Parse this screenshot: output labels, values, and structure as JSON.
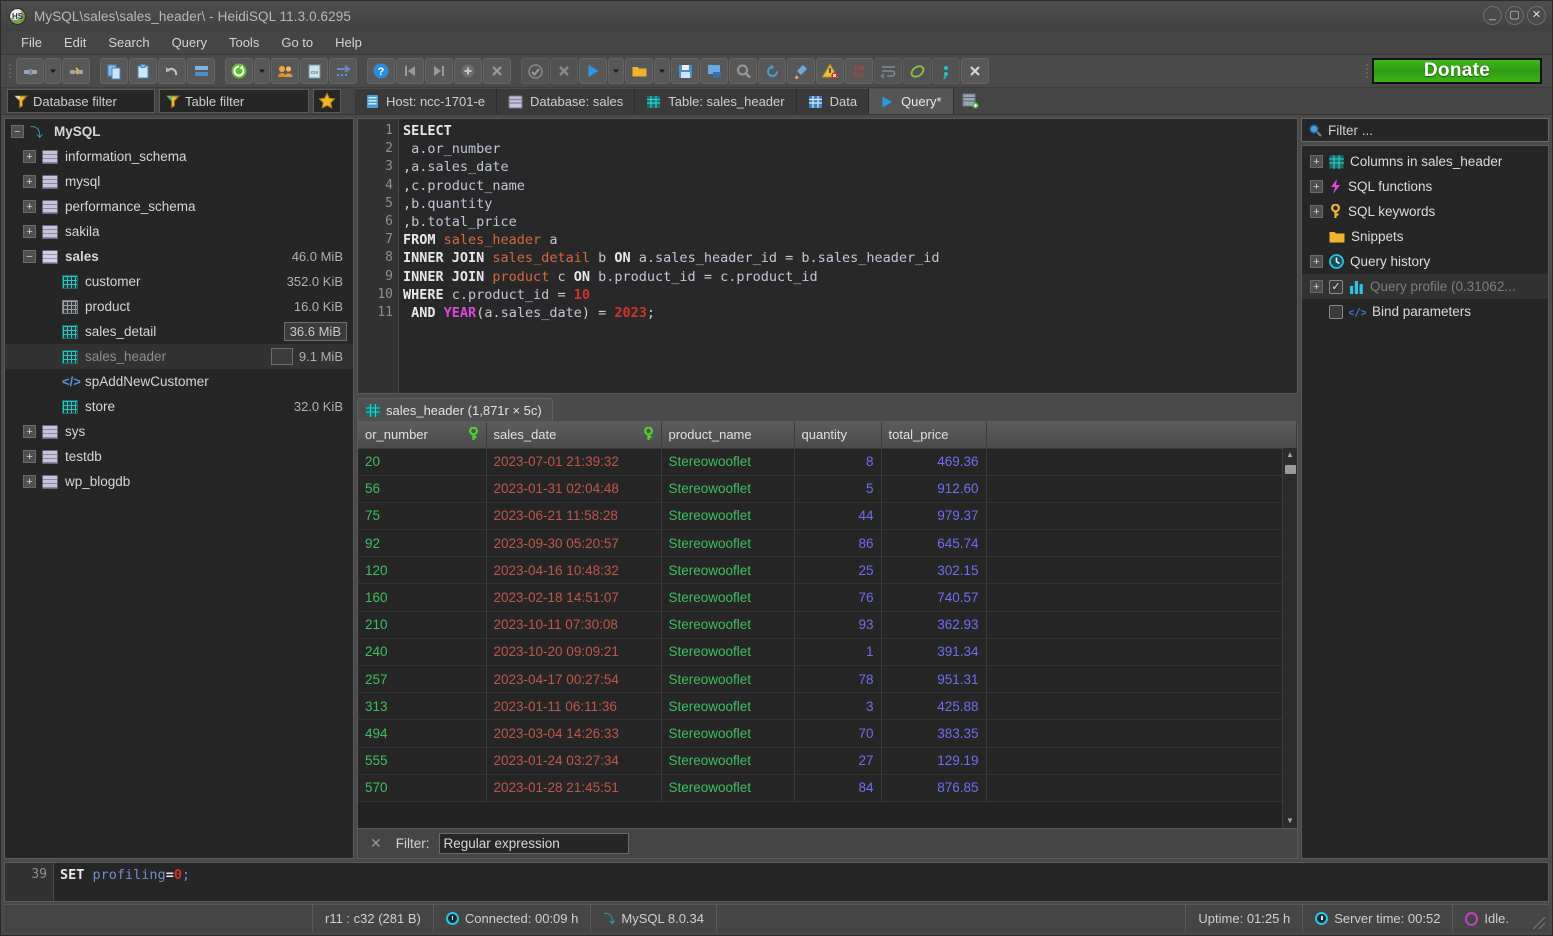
{
  "window": {
    "title": "MySQL\\sales\\sales_header\\ - HeidiSQL 11.3.0.6295",
    "logo_text": "HS",
    "minimize": "_",
    "maximize": "▢",
    "close": "✕"
  },
  "menubar": {
    "items": [
      "File",
      "Edit",
      "Search",
      "Query",
      "Tools",
      "Go to",
      "Help"
    ]
  },
  "toolbar": {
    "donate_label": "Donate",
    "buttons": [
      "connect-icon",
      "connect-dropdown-icon",
      "disconnect-icon",
      "copy-icon",
      "paste-icon",
      "undo-icon",
      "save-icon",
      "refresh-icon",
      "refresh-dropdown-icon",
      "users-icon",
      "csv-export-icon",
      "transfer-icon",
      "help-icon",
      "first-icon",
      "last-icon",
      "add-icon",
      "delete-icon",
      "commit-icon",
      "rollback-icon",
      "run-icon",
      "run-dropdown-icon",
      "open-folder-icon",
      "open-dropdown-icon",
      "save-file-icon",
      "save-as-icon",
      "find-icon",
      "replace-icon",
      "clean-icon",
      "warning-icon",
      "binary-icon",
      "wrap-icon",
      "format-icon",
      "semicolon-icon",
      "close-tab-icon"
    ]
  },
  "filters": {
    "database_filter": "Database filter",
    "table_filter": "Table filter",
    "star_icon": "favorites-star-icon"
  },
  "tabs": [
    {
      "label": "Host: ncc-1701-e",
      "icon": "server-icon",
      "active": false
    },
    {
      "label": "Database: sales",
      "icon": "database-icon",
      "active": false
    },
    {
      "label": "Table: sales_header",
      "icon": "table-icon",
      "active": false
    },
    {
      "label": "Data",
      "icon": "grid-icon",
      "active": false
    },
    {
      "label": "Query*",
      "icon": "play-icon",
      "active": true
    }
  ],
  "new_query_tab_icon": "new-query-icon",
  "tree": {
    "root": {
      "label": "MySQL",
      "icon": "connection-icon",
      "expander": "−"
    },
    "items": [
      {
        "label": "information_schema",
        "size": "",
        "expander": "+",
        "icon": "db",
        "indent": 1,
        "selected": false,
        "dim": false
      },
      {
        "label": "mysql",
        "size": "",
        "expander": "+",
        "icon": "db",
        "indent": 1,
        "selected": false,
        "dim": false
      },
      {
        "label": "performance_schema",
        "size": "",
        "expander": "+",
        "icon": "db",
        "indent": 1,
        "selected": false,
        "dim": false
      },
      {
        "label": "sakila",
        "size": "",
        "expander": "+",
        "icon": "db",
        "indent": 1,
        "selected": false,
        "dim": false
      },
      {
        "label": "sales",
        "size": "46.0 MiB",
        "expander": "−",
        "icon": "db-active",
        "indent": 1,
        "selected": false,
        "dim": false,
        "bold": true
      },
      {
        "label": "customer",
        "size": "352.0 KiB",
        "expander": "",
        "icon": "table",
        "indent": 2,
        "selected": false,
        "dim": false
      },
      {
        "label": "product",
        "size": "16.0 KiB",
        "expander": "",
        "icon": "table-pale",
        "indent": 2,
        "selected": false,
        "dim": false
      },
      {
        "label": "sales_detail",
        "size": "36.6 MiB",
        "expander": "",
        "icon": "table",
        "indent": 2,
        "selected": false,
        "dim": false,
        "size_boxed": true
      },
      {
        "label": "sales_header",
        "size": "9.1 MiB",
        "expander": "",
        "icon": "table",
        "indent": 2,
        "selected": true,
        "dim": true,
        "minibox": true
      },
      {
        "label": "spAddNewCustomer",
        "size": "",
        "expander": "",
        "icon": "proc",
        "indent": 2,
        "selected": false,
        "dim": false
      },
      {
        "label": "store",
        "size": "32.0 KiB",
        "expander": "",
        "icon": "table",
        "indent": 2,
        "selected": false,
        "dim": false
      },
      {
        "label": "sys",
        "size": "",
        "expander": "+",
        "icon": "db",
        "indent": 1,
        "selected": false,
        "dim": false
      },
      {
        "label": "testdb",
        "size": "",
        "expander": "+",
        "icon": "db",
        "indent": 1,
        "selected": false,
        "dim": false
      },
      {
        "label": "wp_blogdb",
        "size": "",
        "expander": "+",
        "icon": "db",
        "indent": 1,
        "selected": false,
        "dim": false
      }
    ]
  },
  "editor": {
    "line_numbers": [
      "1",
      "2",
      "3",
      "4",
      "5",
      "6",
      "7",
      "8",
      "9",
      "10",
      "11"
    ],
    "lines": [
      "SELECT",
      " a.or_number",
      ",a.sales_date",
      ",c.product_name",
      ",b.quantity",
      ",b.total_price",
      "FROM sales_header a",
      "INNER JOIN sales_detail b ON a.sales_header_id = b.sales_header_id",
      "INNER JOIN product c ON b.product_id = c.product_id",
      "WHERE c.product_id = 10",
      " AND YEAR(a.sales_date) = 2023;"
    ]
  },
  "results": {
    "tab_label": "sales_header (1,871r × 5c)",
    "tab_icon": "table-icon",
    "columns": [
      {
        "name": "or_number",
        "key": true
      },
      {
        "name": "sales_date",
        "key": true
      },
      {
        "name": "product_name",
        "key": false
      },
      {
        "name": "quantity",
        "key": false
      },
      {
        "name": "total_price",
        "key": false
      }
    ],
    "rows": [
      [
        "20",
        "2023-07-01 21:39:32",
        "Stereowooflet",
        "8",
        "469.36"
      ],
      [
        "56",
        "2023-01-31 02:04:48",
        "Stereowooflet",
        "5",
        "912.60"
      ],
      [
        "75",
        "2023-06-21 11:58:28",
        "Stereowooflet",
        "44",
        "979.37"
      ],
      [
        "92",
        "2023-09-30 05:20:57",
        "Stereowooflet",
        "86",
        "645.74"
      ],
      [
        "120",
        "2023-04-16 10:48:32",
        "Stereowooflet",
        "25",
        "302.15"
      ],
      [
        "160",
        "2023-02-18 14:51:07",
        "Stereowooflet",
        "76",
        "740.57"
      ],
      [
        "210",
        "2023-10-11 07:30:08",
        "Stereowooflet",
        "93",
        "362.93"
      ],
      [
        "240",
        "2023-10-20 09:09:21",
        "Stereowooflet",
        "1",
        "391.34"
      ],
      [
        "257",
        "2023-04-17 00:27:54",
        "Stereowooflet",
        "78",
        "951.31"
      ],
      [
        "313",
        "2023-01-11 06:11:36",
        "Stereowooflet",
        "3",
        "425.88"
      ],
      [
        "494",
        "2023-03-04 14:26:33",
        "Stereowooflet",
        "70",
        "383.35"
      ],
      [
        "555",
        "2023-01-24 03:27:34",
        "Stereowooflet",
        "27",
        "129.19"
      ],
      [
        "570",
        "2023-01-28 21:45:51",
        "Stereowooflet",
        "84",
        "876.85"
      ]
    ]
  },
  "grid_filter": {
    "close_label": "✕",
    "label": "Filter:",
    "value": "Regular expression"
  },
  "helper": {
    "filter_placeholder": "Filter ...",
    "filter_icon": "search-icon",
    "items": [
      {
        "label": "Columns in sales_header",
        "expander": "+",
        "icon": "table-icon",
        "checkbox": null,
        "dim": false,
        "selected": false
      },
      {
        "label": "SQL functions",
        "expander": "+",
        "icon": "lightning-icon",
        "checkbox": null,
        "dim": false,
        "selected": false
      },
      {
        "label": "SQL keywords",
        "expander": "+",
        "icon": "key-icon",
        "checkbox": null,
        "dim": false,
        "selected": false
      },
      {
        "label": "Snippets",
        "expander": "",
        "icon": "folder-icon",
        "checkbox": null,
        "dim": false,
        "selected": false
      },
      {
        "label": "Query history",
        "expander": "+",
        "icon": "clock-icon",
        "checkbox": null,
        "dim": false,
        "selected": false
      },
      {
        "label": "Query profile (0.31062...",
        "expander": "+",
        "icon": "chart-icon",
        "checkbox": "checked",
        "dim": true,
        "selected": true
      },
      {
        "label": "Bind parameters",
        "expander": "",
        "icon": "code-icon",
        "checkbox": "unchecked",
        "dim": false,
        "selected": false
      }
    ]
  },
  "log": {
    "line_number": "39",
    "keyword": "SET",
    "variable": "profiling",
    "equals": "=",
    "value": "0",
    "terminator": ";"
  },
  "statusbar": {
    "cursor": "r11 : c32 (281 B)",
    "connected": "Connected: 00:09 h",
    "server_version": "MySQL 8.0.34",
    "uptime": "Uptime: 01:25 h",
    "server_time": "Server time: 00:52",
    "state": "Idle."
  }
}
